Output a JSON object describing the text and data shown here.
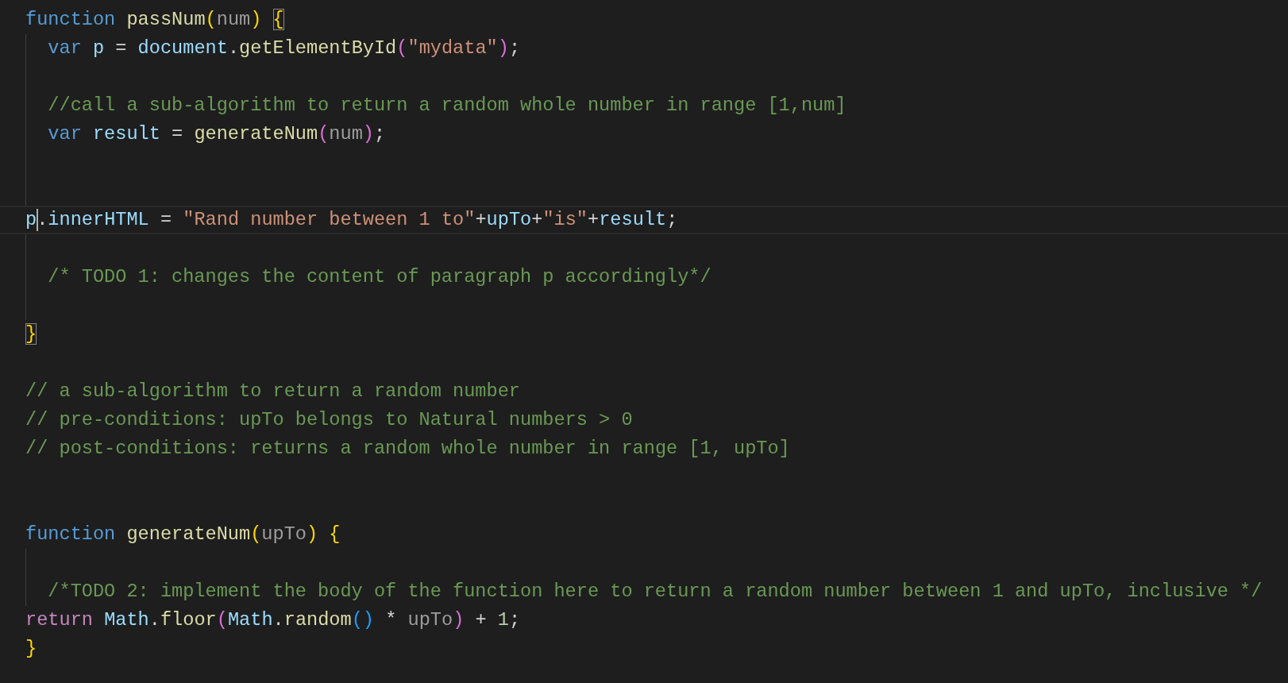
{
  "editor": {
    "lines": [
      {
        "kind": "code",
        "indented": false,
        "current": false,
        "indent_guide": false,
        "tokens": [
          {
            "text": "function ",
            "kind": "keyword"
          },
          {
            "text": "passNum",
            "kind": "function"
          },
          {
            "text": "(",
            "kind": "bracket1"
          },
          {
            "text": "num",
            "kind": "param"
          },
          {
            "text": ") ",
            "kind": "bracket1"
          },
          {
            "text": "{",
            "kind": "match"
          }
        ]
      },
      {
        "kind": "code",
        "indented": true,
        "current": false,
        "indent_guide": true,
        "tokens": [
          {
            "text": "var ",
            "kind": "keyword"
          },
          {
            "text": "p",
            "kind": "variable"
          },
          {
            "text": " = ",
            "kind": "punct"
          },
          {
            "text": "document",
            "kind": "variable"
          },
          {
            "text": ".",
            "kind": "punct"
          },
          {
            "text": "getElementById",
            "kind": "function"
          },
          {
            "text": "(",
            "kind": "bracket2"
          },
          {
            "text": "\"mydata\"",
            "kind": "string"
          },
          {
            "text": ")",
            "kind": "bracket2"
          },
          {
            "text": ";",
            "kind": "punct"
          }
        ]
      },
      {
        "kind": "blank",
        "current": false,
        "indent_guide": true
      },
      {
        "kind": "code",
        "indented": true,
        "current": false,
        "indent_guide": true,
        "tokens": [
          {
            "text": "//call a sub-algorithm to return a random whole number in range [1,num]",
            "kind": "comment"
          }
        ]
      },
      {
        "kind": "code",
        "indented": true,
        "current": false,
        "indent_guide": true,
        "tokens": [
          {
            "text": "var ",
            "kind": "keyword"
          },
          {
            "text": "result",
            "kind": "variable"
          },
          {
            "text": " = ",
            "kind": "punct"
          },
          {
            "text": "generateNum",
            "kind": "function"
          },
          {
            "text": "(",
            "kind": "bracket2"
          },
          {
            "text": "num",
            "kind": "param"
          },
          {
            "text": ")",
            "kind": "bracket2"
          },
          {
            "text": ";",
            "kind": "punct"
          }
        ]
      },
      {
        "kind": "blank",
        "current": false,
        "indent_guide": true
      },
      {
        "kind": "blank",
        "current": false,
        "indent_guide": true
      },
      {
        "kind": "code",
        "indented": false,
        "current": true,
        "indent_guide": false,
        "tokens": [
          {
            "text": "p",
            "kind": "variable",
            "caret_after": true
          },
          {
            "text": ".",
            "kind": "punct"
          },
          {
            "text": "innerHTML",
            "kind": "variable"
          },
          {
            "text": " = ",
            "kind": "punct"
          },
          {
            "text": "\"Rand number between 1 to\"",
            "kind": "string"
          },
          {
            "text": "+",
            "kind": "punct"
          },
          {
            "text": "upTo",
            "kind": "variable"
          },
          {
            "text": "+",
            "kind": "punct"
          },
          {
            "text": "\"is\"",
            "kind": "string"
          },
          {
            "text": "+",
            "kind": "punct"
          },
          {
            "text": "result",
            "kind": "variable"
          },
          {
            "text": ";",
            "kind": "punct"
          }
        ]
      },
      {
        "kind": "blank",
        "current": false,
        "indent_guide": true
      },
      {
        "kind": "code",
        "indented": true,
        "current": false,
        "indent_guide": true,
        "tokens": [
          {
            "text": "/* TODO 1: changes the content of paragraph p accordingly*/",
            "kind": "comment"
          }
        ]
      },
      {
        "kind": "blank",
        "current": false,
        "indent_guide": true
      },
      {
        "kind": "code",
        "indented": false,
        "current": false,
        "indent_guide": false,
        "tokens": [
          {
            "text": "}",
            "kind": "match"
          }
        ]
      },
      {
        "kind": "blank",
        "current": false,
        "indent_guide": false
      },
      {
        "kind": "code",
        "indented": false,
        "current": false,
        "indent_guide": false,
        "tokens": [
          {
            "text": "// a sub-algorithm to return a random number",
            "kind": "comment"
          }
        ]
      },
      {
        "kind": "code",
        "indented": false,
        "current": false,
        "indent_guide": false,
        "tokens": [
          {
            "text": "// pre-conditions: upTo belongs to Natural numbers > 0",
            "kind": "comment"
          }
        ]
      },
      {
        "kind": "code",
        "indented": false,
        "current": false,
        "indent_guide": false,
        "tokens": [
          {
            "text": "// post-conditions: returns a random whole number in range [1, upTo]",
            "kind": "comment"
          }
        ]
      },
      {
        "kind": "blank",
        "current": false,
        "indent_guide": false
      },
      {
        "kind": "blank",
        "current": false,
        "indent_guide": false
      },
      {
        "kind": "code",
        "indented": false,
        "current": false,
        "indent_guide": false,
        "tokens": [
          {
            "text": "function ",
            "kind": "keyword"
          },
          {
            "text": "generateNum",
            "kind": "function"
          },
          {
            "text": "(",
            "kind": "bracket1"
          },
          {
            "text": "upTo",
            "kind": "param"
          },
          {
            "text": ") {",
            "kind": "bracket1"
          }
        ]
      },
      {
        "kind": "blank",
        "current": false,
        "indent_guide": true
      },
      {
        "kind": "code",
        "indented": true,
        "current": false,
        "indent_guide": true,
        "tokens": [
          {
            "text": "/*TODO 2: implement the body of the function here to return a random number between 1 and upTo, inclusive */",
            "kind": "comment"
          }
        ]
      },
      {
        "kind": "code",
        "indented": false,
        "current": false,
        "indent_guide": false,
        "tokens": [
          {
            "text": "return ",
            "kind": "control"
          },
          {
            "text": "Math",
            "kind": "variable"
          },
          {
            "text": ".",
            "kind": "punct"
          },
          {
            "text": "floor",
            "kind": "function"
          },
          {
            "text": "(",
            "kind": "bracket2"
          },
          {
            "text": "Math",
            "kind": "variable"
          },
          {
            "text": ".",
            "kind": "punct"
          },
          {
            "text": "random",
            "kind": "function"
          },
          {
            "text": "()",
            "kind": "bracket3"
          },
          {
            "text": " * ",
            "kind": "punct"
          },
          {
            "text": "upTo",
            "kind": "param"
          },
          {
            "text": ")",
            "kind": "bracket2"
          },
          {
            "text": " + ",
            "kind": "punct"
          },
          {
            "text": "1",
            "kind": "number"
          },
          {
            "text": ";",
            "kind": "punct"
          }
        ]
      },
      {
        "kind": "code",
        "indented": false,
        "current": false,
        "indent_guide": false,
        "tokens": [
          {
            "text": "}",
            "kind": "bracket1"
          }
        ]
      }
    ]
  }
}
